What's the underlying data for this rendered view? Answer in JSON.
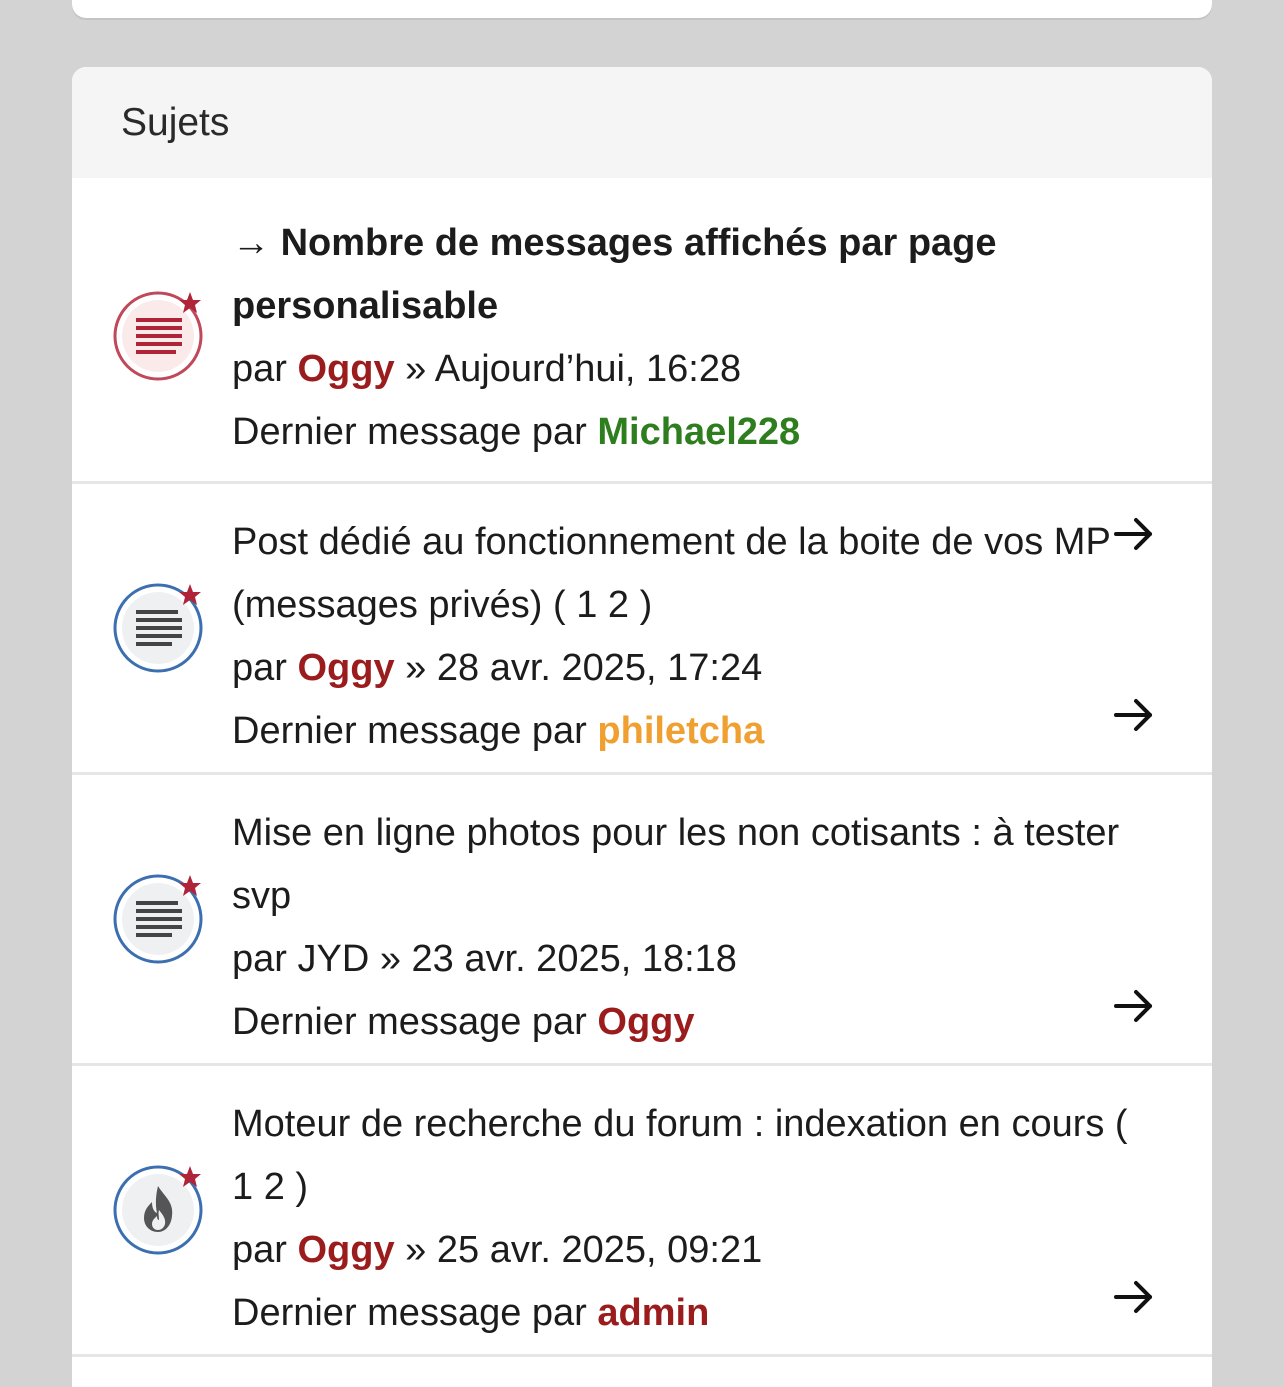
{
  "section_title": "Sujets",
  "topics": [
    {
      "prefix": "→ ",
      "title": "Nombre de messages affichés par page personalisable",
      "by_label": "par",
      "author": "Oggy",
      "sep": "»",
      "date": "Aujourd’hui, 16:28",
      "last_label": "Dernier message par",
      "last_author": "Michael228",
      "icon": "sticky-topic-red-icon"
    },
    {
      "title": "Post dédié au fonctionnement de la boite de vos MP (messages privés) ( 1 2 )",
      "by_label": "par",
      "author": "Oggy",
      "sep": "»",
      "date": "28 avr. 2025, 17:24",
      "last_label": "Dernier message par",
      "last_author": "philetcha",
      "icon": "topic-blue-icon"
    },
    {
      "title": "Mise en ligne photos pour les non cotisants : à tester svp",
      "by_label": "par",
      "author": "JYD",
      "sep": "»",
      "date": "23 avr. 2025, 18:18",
      "last_label": "Dernier message par",
      "last_author": "Oggy",
      "icon": "topic-blue-icon"
    },
    {
      "title": "Moteur de recherche du forum : indexation en cours ( 1 2 )",
      "by_label": "par",
      "author": "Oggy",
      "sep": "»",
      "date": "25 avr. 2025, 09:21",
      "last_label": "Dernier message par",
      "last_author": "admin",
      "icon": "hot-topic-icon"
    }
  ],
  "colors": {
    "user_red": "#9b1c1c",
    "user_green": "#2e7d1e",
    "user_orange": "#f0a030",
    "star": "#b0243a"
  }
}
